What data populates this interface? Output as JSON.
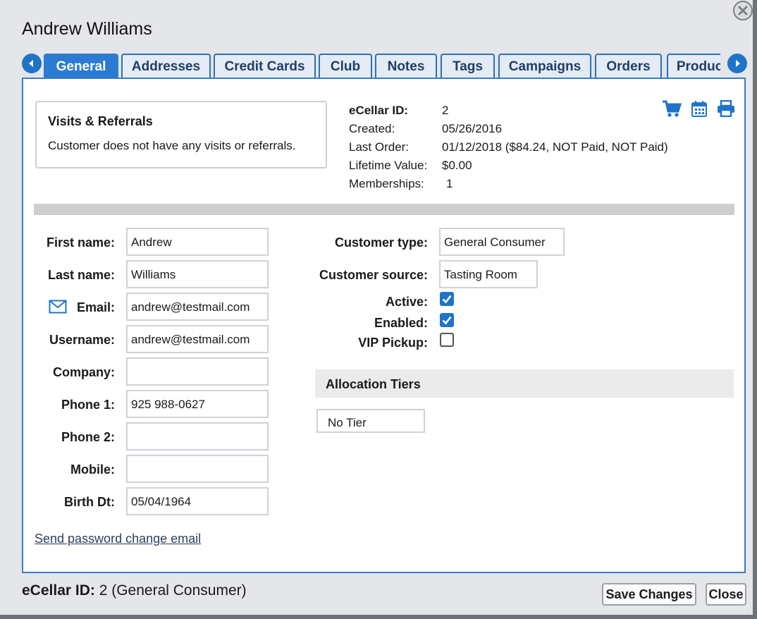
{
  "window": {
    "title": "Andrew Williams"
  },
  "tabs": [
    {
      "label": "General",
      "active": true
    },
    {
      "label": "Addresses"
    },
    {
      "label": "Credit Cards"
    },
    {
      "label": "Club"
    },
    {
      "label": "Notes"
    },
    {
      "label": "Tags"
    },
    {
      "label": "Campaigns"
    },
    {
      "label": "Orders"
    },
    {
      "label": "Products"
    }
  ],
  "visits": {
    "title": "Visits & Referrals",
    "text": "Customer does not have any visits or referrals."
  },
  "summary": {
    "ecellar_id_label": "eCellar ID:",
    "ecellar_id": "2",
    "created_label": "Created:",
    "created": "05/26/2016",
    "last_order_label": "Last Order:",
    "last_order": "01/12/2018 ($84.24, NOT Paid, NOT Paid)",
    "lifetime_label": "Lifetime Value:",
    "lifetime": "$0.00",
    "memberships_label": "Memberships:",
    "memberships": "1"
  },
  "icons": {
    "cart": "cart-icon",
    "calendar": "calendar-icon",
    "print": "print-icon",
    "email": "envelope-icon"
  },
  "form": {
    "first_name_label": "First name:",
    "first_name": "Andrew",
    "last_name_label": "Last name:",
    "last_name": "Williams",
    "email_label": "Email:",
    "email": "andrew@testmail.com",
    "username_label": "Username:",
    "username": "andrew@testmail.com",
    "company_label": "Company:",
    "company": "",
    "phone1_label": "Phone 1:",
    "phone1": "925 988-0627",
    "phone2_label": "Phone 2:",
    "phone2": "",
    "mobile_label": "Mobile:",
    "mobile": "",
    "birth_label": "Birth Dt:",
    "birth": "05/04/1964",
    "customer_type_label": "Customer type:",
    "customer_type": "General Consumer",
    "customer_source_label": "Customer source:",
    "customer_source": "Tasting Room",
    "active_label": "Active:",
    "active": true,
    "enabled_label": "Enabled:",
    "enabled": true,
    "vip_label": "VIP Pickup:",
    "vip": false
  },
  "allocation": {
    "title": "Allocation Tiers",
    "tier": "No Tier"
  },
  "links": {
    "send_password": "Send password change email"
  },
  "footer": {
    "id_label": "eCellar ID:",
    "id_text": "2 (General Consumer)",
    "save": "Save Changes",
    "close": "Close"
  },
  "colors": {
    "accent": "#2b7bd0",
    "tab_border": "#2f6fb6",
    "check": "#1f74c8"
  }
}
